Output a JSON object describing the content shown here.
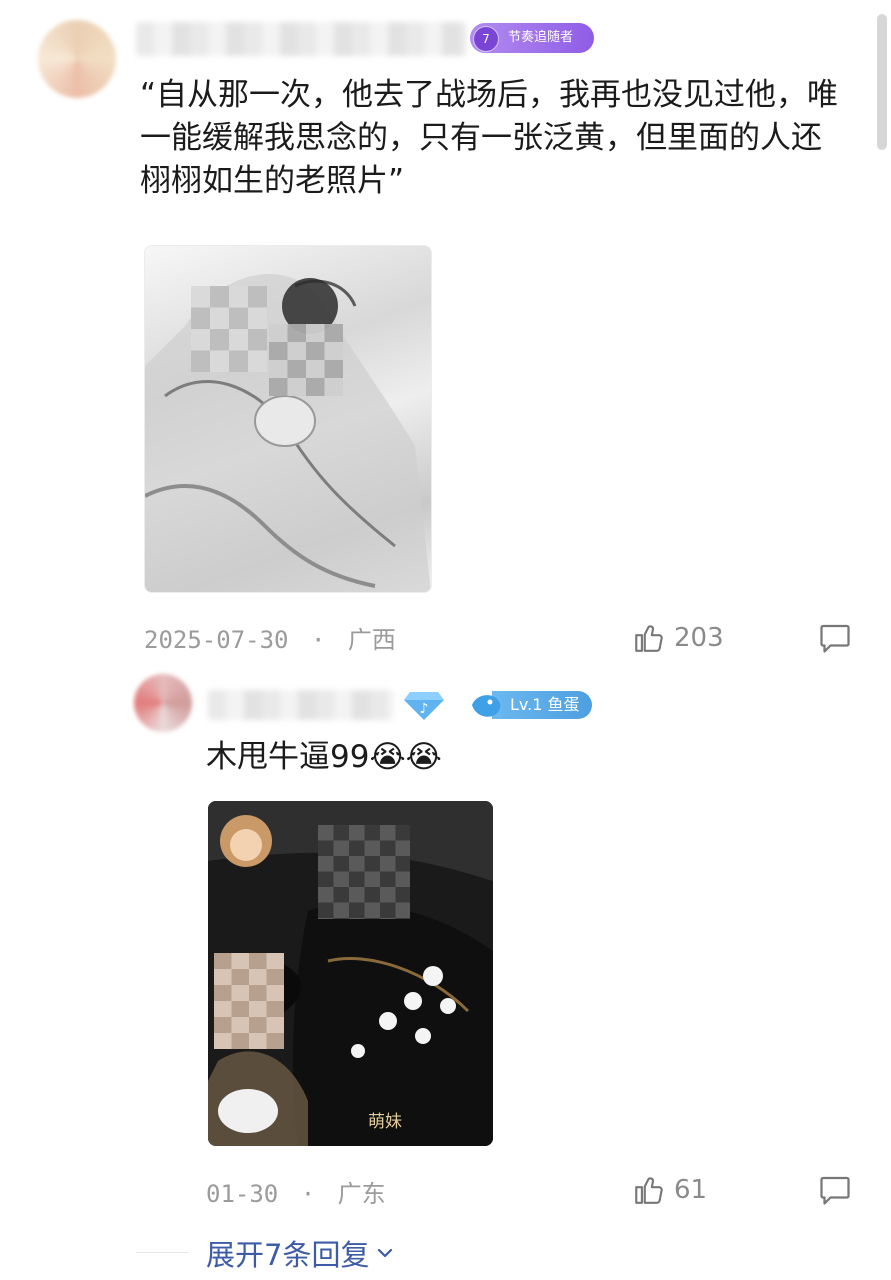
{
  "comment1": {
    "badge_level": "7",
    "badge_label": "节奏追随者",
    "text": "“自从那一次，他去了战场后，我再也没见过他，唯一能缓解我思念的，只有一张泛黄，但里面的人还栩栩如生的老照片”",
    "date": "2025-07-30",
    "location": "广西",
    "separator": "·",
    "likes": "203"
  },
  "reply1": {
    "level_badge": "Lv.1 鱼蛋",
    "text": "木甩牛逼99😭😭",
    "image_caption": "萌妹",
    "date": "01-30",
    "location": "广东",
    "separator": "·",
    "likes": "61"
  },
  "expand_label": "展开7条回复",
  "icons": {
    "like": "thumbs-up-icon",
    "comment": "comment-icon",
    "diamond": "diamond-music-icon",
    "fish": "fish-badge-icon",
    "chevron": "chevron-down-icon"
  }
}
